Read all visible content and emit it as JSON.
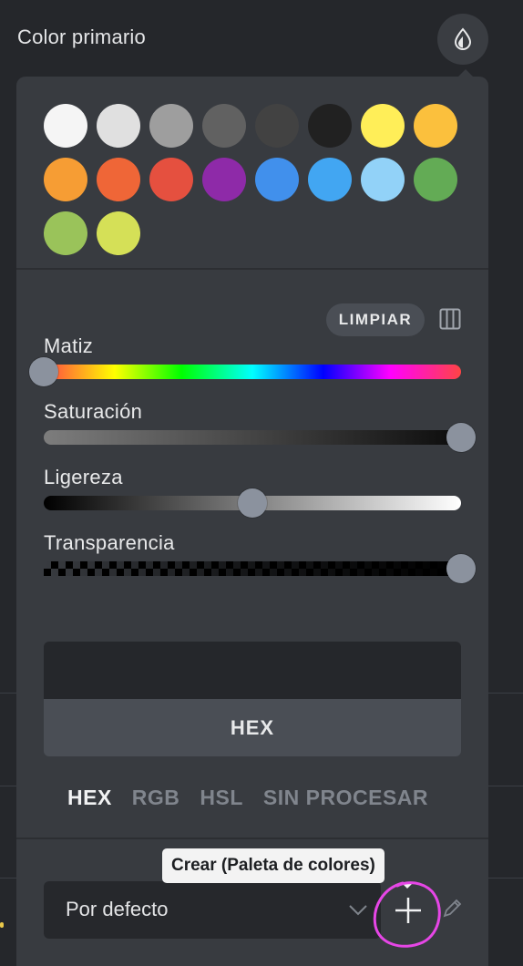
{
  "header": {
    "title": "Color primario",
    "icon": "drop-icon"
  },
  "swatches": [
    {
      "color": "#f5f5f5"
    },
    {
      "color": "#e0e0e0"
    },
    {
      "color": "#9e9e9e"
    },
    {
      "color": "#616161"
    },
    {
      "color": "#424242"
    },
    {
      "color": "#212121"
    },
    {
      "color": "#ffee58"
    },
    {
      "color": "#fbc03d"
    },
    {
      "color": "#f69d34"
    },
    {
      "color": "#ef6637"
    },
    {
      "color": "#e5503f"
    },
    {
      "color": "#8e2aa8"
    },
    {
      "color": "#4190ec"
    },
    {
      "color": "#42a6f2"
    },
    {
      "color": "#92d2f8"
    },
    {
      "color": "#63ab55"
    },
    {
      "color": "#9ac35a"
    },
    {
      "color": "#d5e057"
    }
  ],
  "picker": {
    "clear_label": "LIMPIAR",
    "sliders": [
      {
        "label": "Matiz",
        "value": 0.0
      },
      {
        "label": "Saturación",
        "value": 1.0
      },
      {
        "label": "Ligereza",
        "value": 0.5
      },
      {
        "label": "Transparencia",
        "value": 1.0
      }
    ],
    "preview_color": "#25272b",
    "format_label": "HEX"
  },
  "modes": [
    {
      "label": "HEX",
      "active": true
    },
    {
      "label": "RGB",
      "active": false
    },
    {
      "label": "HSL",
      "active": false
    },
    {
      "label": "SIN PROCESAR",
      "active": false
    }
  ],
  "palette": {
    "selected": "Por defecto",
    "tooltip": "Crear (Paleta de colores)"
  },
  "colors": {
    "background": "#25272b",
    "panel": "#383b40",
    "highlight": "#e646e6"
  }
}
